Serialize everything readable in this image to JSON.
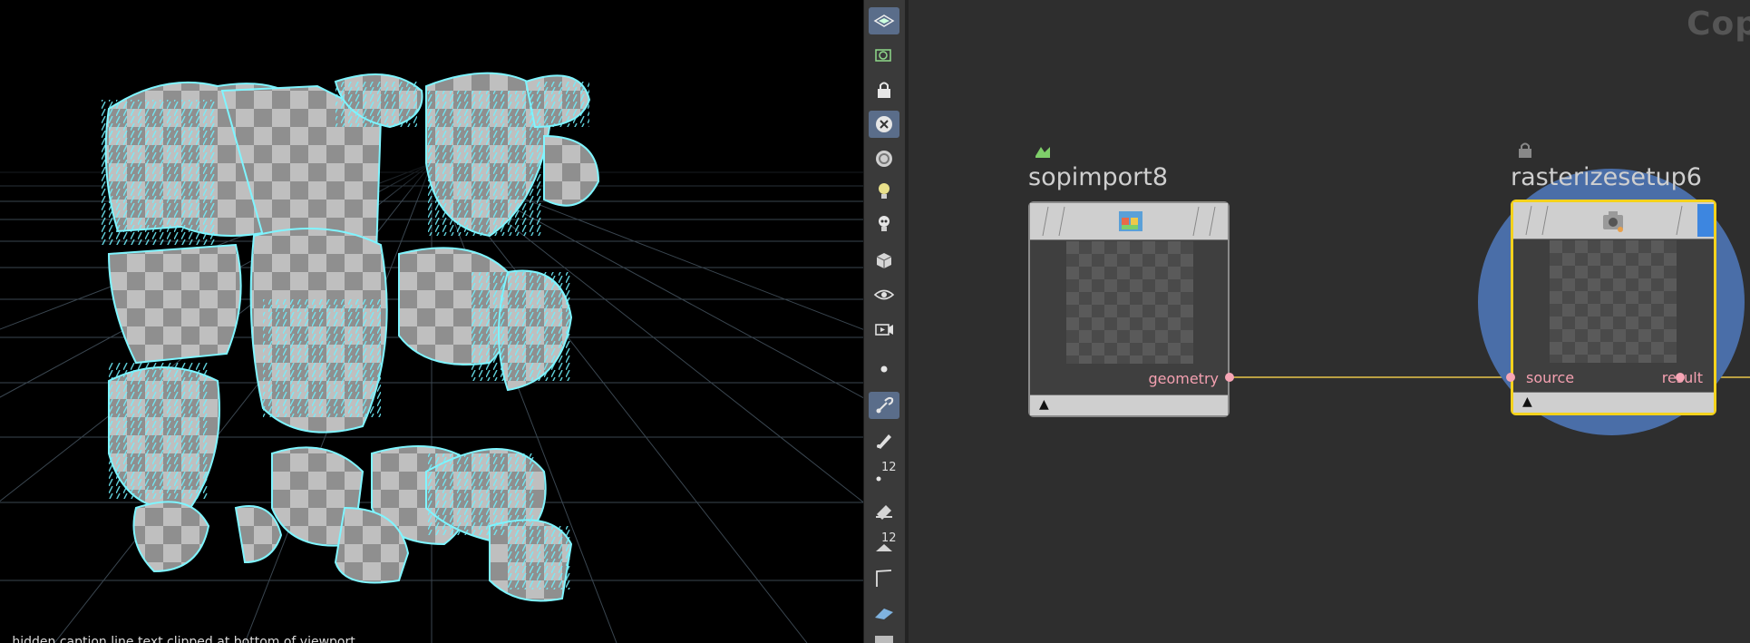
{
  "viewport": {
    "caption": "...hidden caption line text clipped at bottom of viewport..."
  },
  "toolbar": {
    "items": [
      {
        "name": "display-options-icon",
        "active": true
      },
      {
        "name": "uv-view-icon",
        "active": false
      },
      {
        "name": "lock-icon",
        "active": false
      },
      {
        "name": "close-x-icon",
        "active": true
      },
      {
        "name": "shading-sphere-icon",
        "active": false
      },
      {
        "name": "light-bulb-icon",
        "active": false
      },
      {
        "name": "light-bulb-skull-icon",
        "active": false
      },
      {
        "name": "geometry-cube-icon",
        "active": false
      },
      {
        "name": "camera-eye-icon",
        "active": false
      },
      {
        "name": "camera-play-icon",
        "active": false
      },
      {
        "name": "point-icon",
        "active": false
      },
      {
        "name": "brush-icon",
        "active": true
      },
      {
        "name": "pen-icon",
        "active": false
      },
      {
        "name": "point-number-icon",
        "active": false,
        "number": "12"
      },
      {
        "name": "paint-bucket-icon",
        "active": false
      },
      {
        "name": "prim-number-icon",
        "active": false,
        "number": "12"
      },
      {
        "name": "angle-icon",
        "active": false
      },
      {
        "name": "plane-icon",
        "active": false
      }
    ]
  },
  "network": {
    "title": "Cop",
    "nodes": [
      {
        "name": "sopimport8",
        "output_label": "geometry"
      },
      {
        "name": "rasterizesetup6",
        "input_label": "source",
        "output_label": "result"
      }
    ]
  }
}
